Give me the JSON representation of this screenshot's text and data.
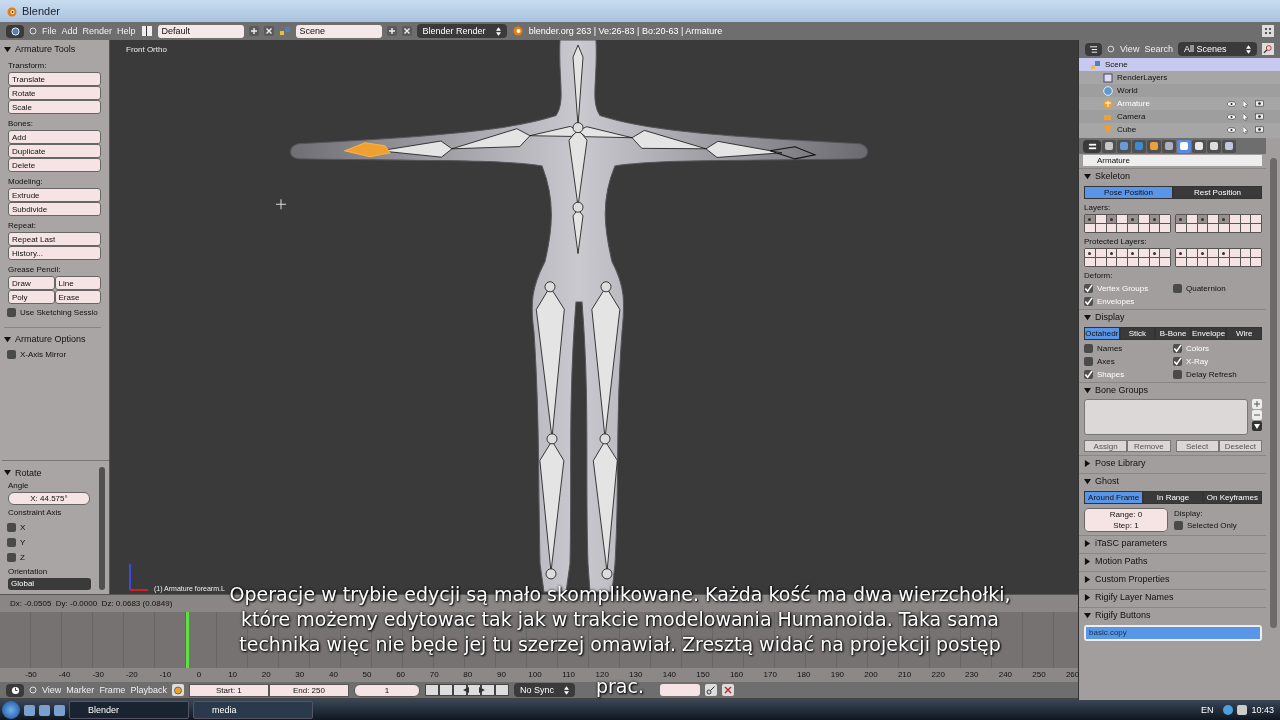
{
  "window": {
    "title": "Blender"
  },
  "header": {
    "menus": [
      "File",
      "Add",
      "Render",
      "Help"
    ],
    "layout": "Default",
    "scene": "Scene",
    "engine": "Blender Render",
    "stats": "blender.org 263 | Ve:26-83 | Bo:20-63 | Armature"
  },
  "toolshelf": {
    "title": "Armature Tools",
    "expanded": true,
    "groups": [
      {
        "label": "Transform:",
        "kind": "column",
        "buttons": [
          "Translate",
          "Rotate",
          "Scale"
        ]
      },
      {
        "label": "Bones:",
        "kind": "column",
        "buttons": [
          "Add",
          "Duplicate",
          "Delete"
        ]
      },
      {
        "label": "Modeling:",
        "kind": "column",
        "buttons": [
          "Extrude",
          "Subdivide"
        ]
      },
      {
        "label": "Repeat:",
        "kind": "column",
        "buttons": [
          "Repeat Last",
          "History..."
        ]
      },
      {
        "label": "Grease Pencil:",
        "kind": "grid",
        "buttons": [
          "Draw",
          "Line",
          "Poly",
          "Erase"
        ]
      }
    ],
    "sketching": {
      "label": "Use Sketching Sessio",
      "checked": false
    },
    "options_title": "Armature Options",
    "options_expanded": true,
    "x_mirror": {
      "label": "X-Axis Mirror",
      "checked": false
    }
  },
  "operator": {
    "title": "Rotate",
    "expanded": true,
    "angle_label": "Angle",
    "angle": "X: 44.575°",
    "constraint_label": "Constraint Axis",
    "axes": [
      {
        "label": "X",
        "checked": false
      },
      {
        "label": "Y",
        "checked": false
      },
      {
        "label": "Z",
        "checked": false
      }
    ],
    "orientation_label": "Orientation",
    "orientation": "Global"
  },
  "viewport": {
    "view_name": "Front Ortho",
    "object_info": "(1) Armature forearm.L"
  },
  "info": "Dx: -0.0505  Dy: -0.0000  Dz: 0.0683 (0.0849)",
  "subtitle": [
    "Operacje w trybie edycji są mało skomplikowane. Każda kość ma dwa wierzchołki,",
    "które możemy edytowac tak jak w trakcie modelowania Humanoida. Taka sama",
    "technika więc nie będe jej tu szerzej omawiał. Zresztą widać na projekcji postęp",
    "prac."
  ],
  "timeline": {
    "ticks": [
      "-50",
      "-40",
      "-30",
      "-20",
      "-10",
      "0",
      "10",
      "20",
      "30",
      "40",
      "50",
      "60",
      "70",
      "80",
      "90",
      "100",
      "110",
      "120",
      "130",
      "140",
      "150",
      "160",
      "170",
      "180",
      "190",
      "200",
      "210",
      "220",
      "230",
      "240",
      "250",
      "260"
    ],
    "menus": [
      "View",
      "Marker",
      "Frame",
      "Playback"
    ],
    "start": "Start: 1",
    "end": "End: 250",
    "current": "1",
    "sync": "No Sync"
  },
  "outliner": {
    "menus": [
      "View",
      "Search"
    ],
    "filter": "All Scenes",
    "tree": [
      {
        "label": "Scene",
        "kind": "scene",
        "selected": true,
        "active": false,
        "children": [
          {
            "label": "RenderLayers",
            "kind": "renderlayers",
            "selected": false,
            "active": false
          },
          {
            "label": "World",
            "kind": "world",
            "selected": false,
            "active": false
          },
          {
            "label": "Armature",
            "kind": "armature",
            "selected": false,
            "active": true
          },
          {
            "label": "Camera",
            "kind": "camera",
            "selected": false,
            "active": false
          },
          {
            "label": "Cube",
            "kind": "mesh",
            "selected": false,
            "active": false
          }
        ]
      }
    ]
  },
  "properties": {
    "tabs": [
      {
        "selected": false
      },
      {
        "selected": false
      },
      {
        "selected": false
      },
      {
        "selected": false
      },
      {
        "selected": false
      },
      {
        "selected": true
      },
      {
        "selected": false
      },
      {
        "selected": false
      },
      {
        "selected": false
      }
    ],
    "name": "Armature",
    "panels": [
      {
        "kind": "skeleton",
        "title": "Skeleton",
        "expanded": true,
        "modes": [
          {
            "label": "Pose Position",
            "selected": true
          },
          {
            "label": "Rest Position",
            "selected": false
          }
        ],
        "layers_label": "Layers:",
        "layers": [
          {
            "dot": true
          },
          {
            "dot": false
          },
          {
            "dot": true
          },
          {
            "dot": false
          },
          {
            "dot": true
          },
          {
            "dot": false
          },
          {
            "dot": true
          },
          {
            "dot": false
          },
          {
            "dot": false
          },
          {
            "dot": false
          },
          {
            "dot": false
          },
          {
            "dot": false
          },
          {
            "dot": false
          },
          {
            "dot": false
          },
          {
            "dot": false
          },
          {
            "dot": false
          },
          {
            "dot": true
          },
          {
            "dot": false
          },
          {
            "dot": true
          },
          {
            "dot": false
          },
          {
            "dot": true
          },
          {
            "dot": false
          },
          {
            "dot": false
          },
          {
            "dot": false
          },
          {
            "dot": false
          },
          {
            "dot": false
          },
          {
            "dot": false
          },
          {
            "dot": false
          },
          {
            "dot": false
          },
          {
            "dot": false
          },
          {
            "dot": false
          },
          {
            "dot": false
          }
        ],
        "protected_label": "Protected Layers:",
        "protected": [
          {
            "dot": true
          },
          {
            "dot": false
          },
          {
            "dot": true
          },
          {
            "dot": false
          },
          {
            "dot": true
          },
          {
            "dot": false
          },
          {
            "dot": true
          },
          {
            "dot": false
          },
          {
            "dot": false
          },
          {
            "dot": false
          },
          {
            "dot": false
          },
          {
            "dot": false
          },
          {
            "dot": false
          },
          {
            "dot": false
          },
          {
            "dot": false
          },
          {
            "dot": false
          },
          {
            "dot": true
          },
          {
            "dot": false
          },
          {
            "dot": true
          },
          {
            "dot": false
          },
          {
            "dot": true
          },
          {
            "dot": false
          },
          {
            "dot": false
          },
          {
            "dot": false
          },
          {
            "dot": false
          },
          {
            "dot": false
          },
          {
            "dot": false
          },
          {
            "dot": false
          },
          {
            "dot": false
          },
          {
            "dot": false
          },
          {
            "dot": false
          },
          {
            "dot": false
          }
        ],
        "deform_label": "Deform:",
        "deform": [
          {
            "label": "Vertex Groups",
            "checked": true
          },
          {
            "label": "Quaternion",
            "checked": false
          },
          {
            "label": "Envelopes",
            "checked": true
          }
        ]
      },
      {
        "kind": "display",
        "title": "Display",
        "expanded": true,
        "modes": [
          {
            "label": "Octahedr",
            "selected": true
          },
          {
            "label": "Stick",
            "selected": false
          },
          {
            "label": "B-Bone",
            "selected": false
          },
          {
            "label": "Envelope",
            "selected": false
          },
          {
            "label": "Wire",
            "selected": false
          }
        ],
        "options": [
          {
            "label": "Names",
            "checked": false
          },
          {
            "label": "Colors",
            "checked": true
          },
          {
            "label": "Axes",
            "checked": false
          },
          {
            "label": "X-Ray",
            "checked": true
          },
          {
            "label": "Shapes",
            "checked": true
          },
          {
            "label": "Delay Refresh",
            "checked": false
          }
        ]
      },
      {
        "kind": "bone_groups",
        "title": "Bone Groups",
        "expanded": true,
        "buttons": [
          "Assign",
          "Remove",
          "Select",
          "Deselect"
        ]
      },
      {
        "title": "Pose Library",
        "expanded": false
      },
      {
        "kind": "ghost",
        "title": "Ghost",
        "expanded": true,
        "modes": [
          {
            "label": "Around Frame",
            "selected": true
          },
          {
            "label": "In Range",
            "selected": false
          },
          {
            "label": "On Keyframes",
            "selected": false
          }
        ],
        "range": "Range: 0",
        "step": "Step: 1",
        "display_label": "Display:",
        "selected_only": {
          "label": "Selected Only",
          "checked": false
        }
      },
      {
        "title": "iTaSC parameters",
        "expanded": false
      },
      {
        "title": "Motion Paths",
        "expanded": false
      },
      {
        "title": "Custom Properties",
        "expanded": false
      },
      {
        "title": "Rigify Layer Names",
        "expanded": false
      },
      {
        "kind": "rigify",
        "title": "Rigify Buttons",
        "expanded": true,
        "items": [
          {
            "label": "basic.copy",
            "selected": true
          }
        ]
      }
    ]
  },
  "taskbar": {
    "tasks": [
      {
        "label": "Blender",
        "selected": true
      },
      {
        "label": "media",
        "selected": false
      }
    ],
    "language": "EN",
    "clock": "10:43"
  }
}
